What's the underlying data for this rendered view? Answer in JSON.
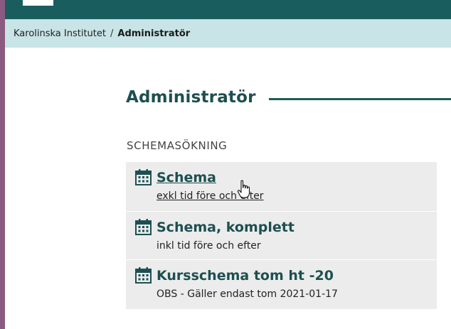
{
  "breadcrumb": {
    "parent": "Karolinska Institutet",
    "separator": "/",
    "current": "Administratör"
  },
  "main": {
    "title": "Administratör",
    "section_label": "SCHEMASÖKNING",
    "items": [
      {
        "title": "Schema",
        "subtitle": "exkl tid före och efter",
        "icon": "calendar-icon"
      },
      {
        "title": "Schema, komplett",
        "subtitle": "inkl tid före och efter",
        "icon": "calendar-icon"
      },
      {
        "title": "Kursschema tom ht -20",
        "subtitle": "OBS - Gäller endast tom 2021-01-17",
        "icon": "calendar-icon"
      }
    ]
  },
  "colors": {
    "topbar": "#1a5d5f",
    "breadcrumb_bg": "#c8e4e6",
    "accent_text": "#1d4f52",
    "left_accent": "#8b5a80",
    "menu_bg": "#ececec"
  },
  "icons": {
    "cursor": "hand-pointer-icon"
  }
}
